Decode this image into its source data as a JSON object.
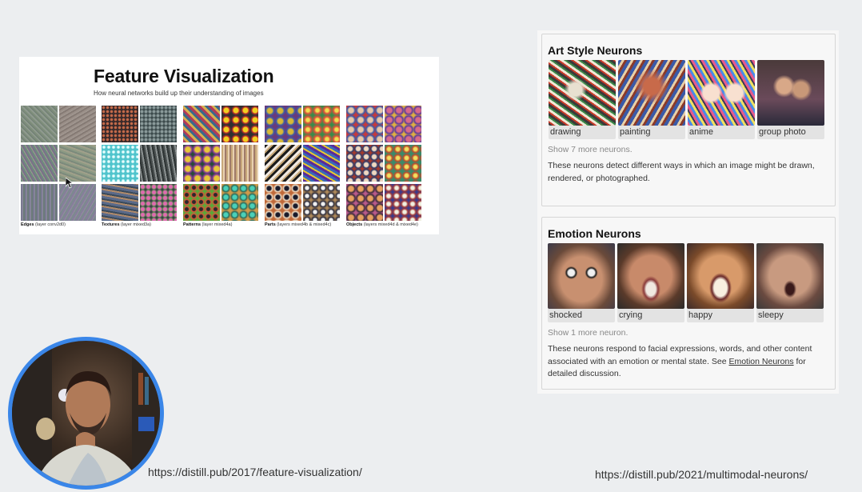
{
  "feature_viz": {
    "title": "Feature Visualization",
    "subtitle": "How neural networks build up their understanding of images",
    "groups": [
      {
        "caption_bold": "Edges",
        "caption_rest": " (layer conv2d0)"
      },
      {
        "caption_bold": "Textures",
        "caption_rest": " (layer mixed3a)"
      },
      {
        "caption_bold": "Patterns",
        "caption_rest": " (layer mixed4a)"
      },
      {
        "caption_bold": "Parts",
        "caption_rest": " (layers mixed4b & mixed4c)"
      },
      {
        "caption_bold": "Objects",
        "caption_rest": " (layers mixed4d & mixed4e)"
      }
    ]
  },
  "art_style": {
    "title": "Art Style Neurons",
    "neurons": [
      "drawing",
      "painting",
      "anime",
      "group photo"
    ],
    "show_more": "Show 7 more neurons.",
    "description": "These neurons detect different ways in which an image might be drawn, rendered, or photographed."
  },
  "emotion": {
    "title": "Emotion Neurons",
    "neurons": [
      "shocked",
      "crying",
      "happy",
      "sleepy"
    ],
    "show_more": "Show 1 more neuron.",
    "description_before": "These neurons respond to facial expressions, words, and other content associated with an emotion or mental state. See ",
    "description_link": "Emotion Neurons",
    "description_after": " for detailed discussion."
  },
  "urls": {
    "left": "https://distill.pub/2017/feature-visualization/",
    "right": "https://distill.pub/2021/multimodal-neurons/"
  }
}
